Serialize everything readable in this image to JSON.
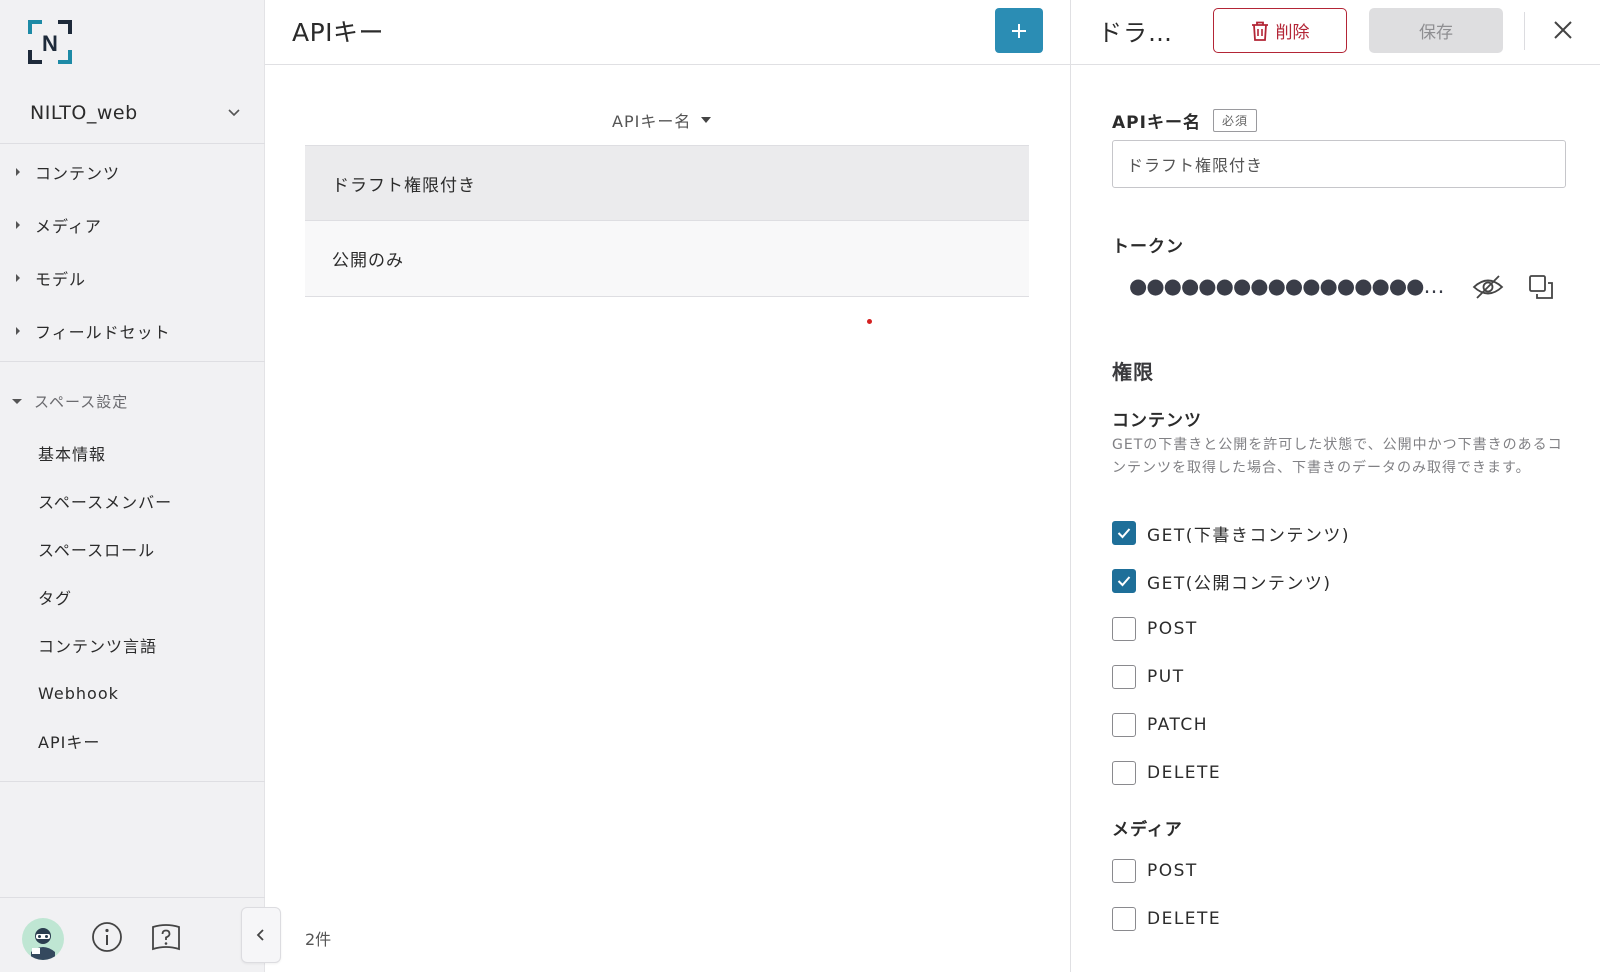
{
  "sidebar": {
    "logo_letter": "N",
    "space_name": "NILTO_web",
    "nav": [
      {
        "label": "コンテンツ"
      },
      {
        "label": "メディア"
      },
      {
        "label": "モデル"
      },
      {
        "label": "フィールドセット"
      }
    ],
    "section_label": "スペース設定",
    "sub_items": [
      {
        "label": "基本情報"
      },
      {
        "label": "スペースメンバー"
      },
      {
        "label": "スペースロール"
      },
      {
        "label": "タグ"
      },
      {
        "label": "コンテンツ言語"
      },
      {
        "label": "Webhook"
      },
      {
        "label": "APIキー"
      }
    ]
  },
  "main": {
    "title": "APIキー",
    "add_label": "+",
    "column_header": "APIキー名",
    "rows": [
      {
        "name": "ドラフト権限付き"
      },
      {
        "name": "公開のみ"
      }
    ],
    "count": "2件"
  },
  "detail": {
    "title": "ドラ…",
    "delete_label": "削除",
    "save_label": "保存",
    "name_label": "APIキー名",
    "required_badge": "必須",
    "name_value": "ドラフト権限付き",
    "token_label": "トークン",
    "token_masked": "●●●●●●●●●●●●●●●●●…",
    "permissions_title": "権限",
    "content_section": {
      "title": "コンテンツ",
      "description": "GETの下書きと公開を許可した状態で、公開中かつ下書きのあるコンテンツを取得した場合、下書きのデータのみ取得できます。",
      "options": [
        {
          "label": "GET(下書きコンテンツ)",
          "checked": true
        },
        {
          "label": "GET(公開コンテンツ)",
          "checked": true
        },
        {
          "label": "POST",
          "checked": false
        },
        {
          "label": "PUT",
          "checked": false
        },
        {
          "label": "PATCH",
          "checked": false
        },
        {
          "label": "DELETE",
          "checked": false
        }
      ]
    },
    "media_section": {
      "title": "メディア",
      "options": [
        {
          "label": "POST",
          "checked": false
        },
        {
          "label": "DELETE",
          "checked": false
        }
      ]
    }
  },
  "colors": {
    "accent": "#2b8db4",
    "checkbox": "#1e6f99",
    "danger": "#b32536"
  }
}
